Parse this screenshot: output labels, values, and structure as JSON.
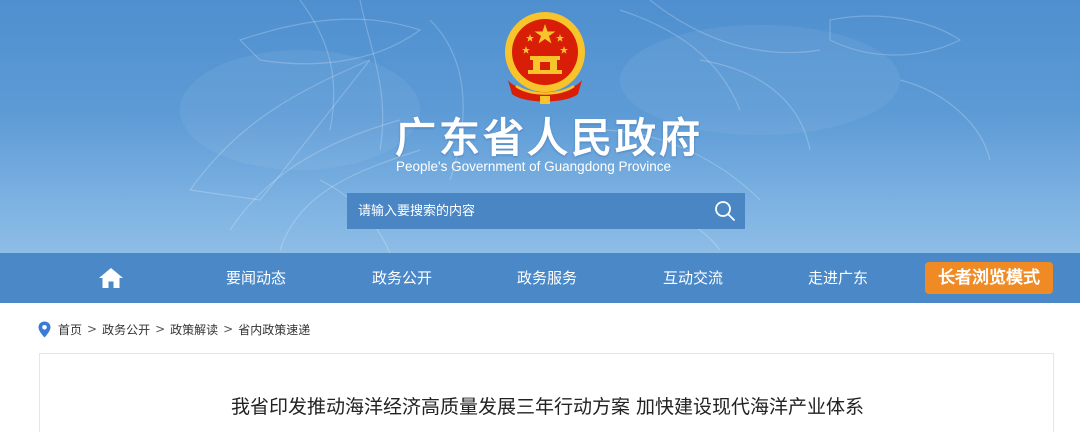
{
  "header": {
    "site_title": "广东省人民政府",
    "site_subtitle": "People's Government of Guangdong Province",
    "emblem_icon": "national-emblem-icon"
  },
  "search": {
    "placeholder": "请输入要搜索的内容",
    "icon": "search-icon"
  },
  "nav": {
    "home_icon": "home-icon",
    "items": [
      {
        "label": "要闻动态"
      },
      {
        "label": "政务公开"
      },
      {
        "label": "政务服务"
      },
      {
        "label": "互动交流"
      },
      {
        "label": "走进广东"
      }
    ],
    "elder_mode_label": "长者浏览模式"
  },
  "breadcrumb": {
    "icon": "location-pin-icon",
    "separator": ">",
    "items": [
      {
        "label": "首页"
      },
      {
        "label": "政务公开"
      },
      {
        "label": "政策解读"
      },
      {
        "label": "省内政策速递"
      }
    ]
  },
  "article": {
    "title": "我省印发推动海洋经济高质量发展三年行动方案 加快建设现代海洋产业体系"
  },
  "colors": {
    "banner_top": "#4f8fcf",
    "banner_bottom": "#8ebde6",
    "nav_bg": "#4b88c7",
    "search_bg": "#4a85c4",
    "elder_button": "#f08a24",
    "emblem_red": "#d81e06",
    "emblem_gold": "#f7c52b",
    "pin_blue": "#3a7bd5"
  }
}
